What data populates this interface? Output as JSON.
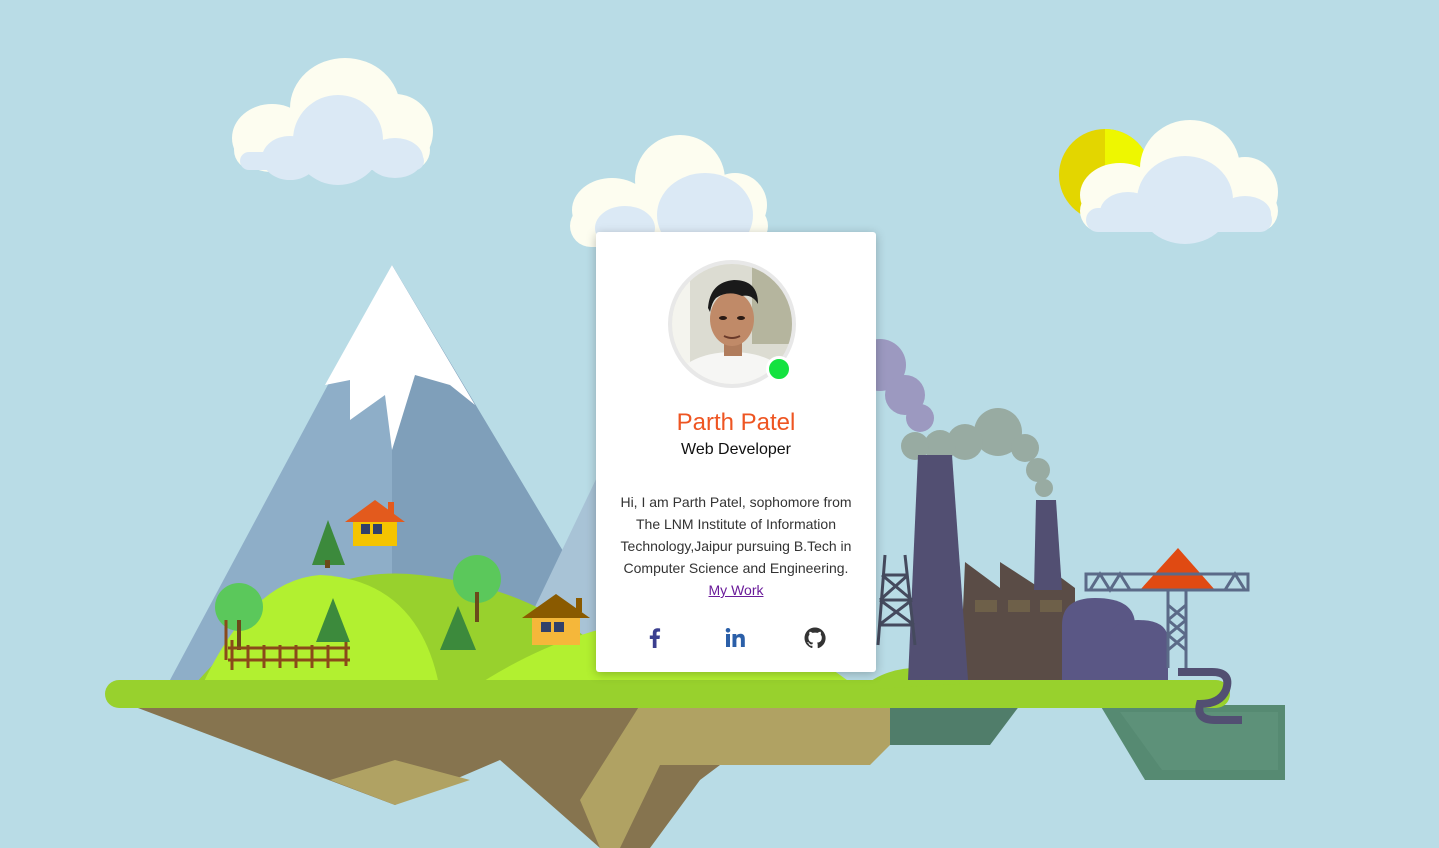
{
  "profile": {
    "name": "Parth Patel",
    "role": "Web Developer",
    "bio": "Hi, I am Parth Patel, sophomore from The LNM Institute of Information Technology,Jaipur pursuing B.Tech in Computer Science and Engineering.",
    "link_label": "My Work",
    "online": true
  },
  "social": [
    {
      "name": "facebook-icon",
      "label": "Facebook"
    },
    {
      "name": "linkedin-icon",
      "label": "LinkedIn"
    },
    {
      "name": "github-icon",
      "label": "GitHub"
    }
  ],
  "colors": {
    "background": "#b9dce6",
    "name": "#ee5522",
    "status_online": "#14e240",
    "facebook": "#3b3f8f",
    "linkedin": "#2b5fa8",
    "github": "#333333"
  }
}
